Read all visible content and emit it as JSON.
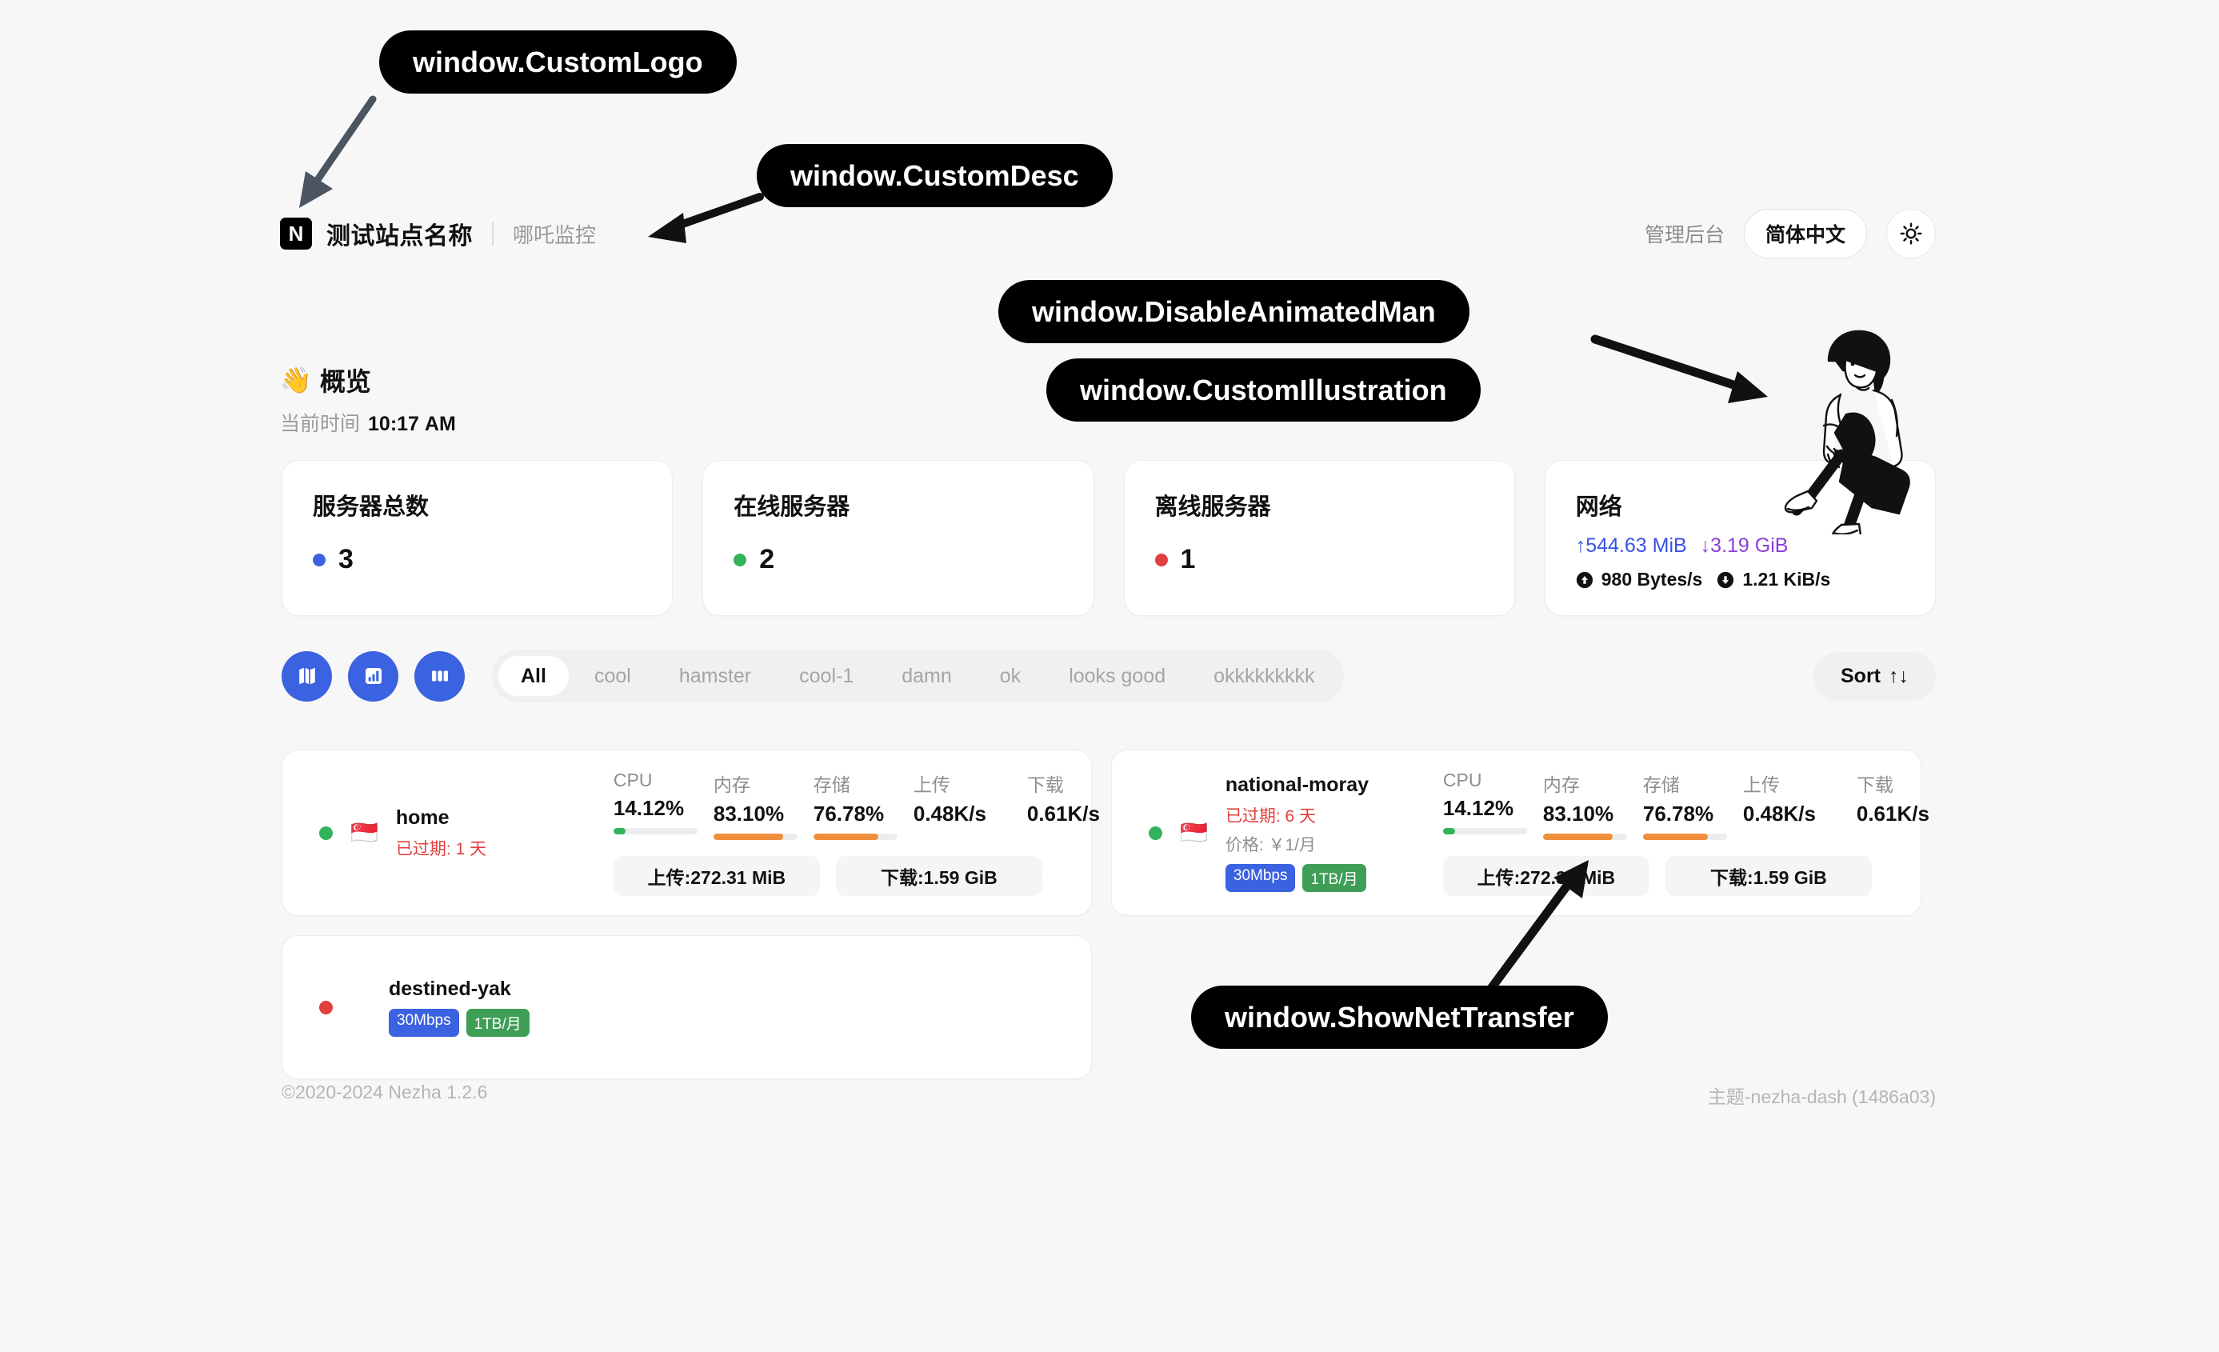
{
  "header": {
    "logo_letter": "N",
    "site_name": "测试站点名称",
    "site_desc": "哪吒监控",
    "admin_link": "管理后台",
    "language": "简体中文"
  },
  "overview": {
    "wave_emoji": "👋",
    "title": "概览",
    "time_label": "当前时间",
    "time_value": "10:17 AM"
  },
  "stats": [
    {
      "title": "服务器总数",
      "value": "3",
      "dot_color": "#3b62e0"
    },
    {
      "title": "在线服务器",
      "value": "2",
      "dot_color": "#35b35c"
    },
    {
      "title": "离线服务器",
      "value": "1",
      "dot_color": "#e0403f"
    }
  ],
  "network": {
    "title": "网络",
    "up_total": "↑544.63 MiB",
    "down_total": "↓3.19 GiB",
    "up_total_color": "#3b52e0",
    "down_total_color": "#8a3fd6",
    "up_speed": "980 Bytes/s",
    "down_speed": "1.21 KiB/s"
  },
  "filters": {
    "view_buttons": [
      "map-icon",
      "chart-icon",
      "columns-icon"
    ],
    "tabs": [
      "All",
      "cool",
      "hamster",
      "cool-1",
      "damn",
      "ok",
      "looks good",
      "okkkkkkkkk"
    ],
    "active_tab": "All",
    "sort_label": "Sort",
    "sort_icon": "↑↓",
    "accent_color": "#3b62e0"
  },
  "metric_labels": {
    "cpu": "CPU",
    "memory": "内存",
    "storage": "存储",
    "upload": "上传",
    "download": "下载"
  },
  "servers": [
    {
      "name": "home",
      "flag": "🇸🇬",
      "status_color": "#35b35c",
      "expire": "已过期: 1 天",
      "price": null,
      "badges": [],
      "has_metrics": true,
      "cpu": "14.12%",
      "cpu_pct": 14,
      "memory": "83.10%",
      "memory_pct": 83,
      "storage": "76.78%",
      "storage_pct": 77,
      "upload": "0.48K/s",
      "download": "0.61K/s",
      "transfer_up": "上传:272.31 MiB",
      "transfer_down": "下载:1.59 GiB"
    },
    {
      "name": "national-moray",
      "flag": "🇸🇬",
      "status_color": "#35b35c",
      "expire": "已过期: 6 天",
      "price": "价格: ￥1/月",
      "badges": [
        {
          "text": "30Mbps",
          "color": "blue"
        },
        {
          "text": "1TB/月",
          "color": "green"
        }
      ],
      "has_metrics": true,
      "cpu": "14.12%",
      "cpu_pct": 14,
      "memory": "83.10%",
      "memory_pct": 83,
      "storage": "76.78%",
      "storage_pct": 77,
      "upload": "0.48K/s",
      "download": "0.61K/s",
      "transfer_up": "上传:272.31 MiB",
      "transfer_down": "下载:1.59 GiB"
    },
    {
      "name": "destined-yak",
      "flag": null,
      "status_color": "#e0403f",
      "expire": null,
      "price": null,
      "badges": [
        {
          "text": "30Mbps",
          "color": "blue"
        },
        {
          "text": "1TB/月",
          "color": "green"
        }
      ],
      "has_metrics": false
    }
  ],
  "footer": {
    "left": "©2020-2024 Nezha 1.2.6",
    "right": "主题-nezha-dash (1486a03)"
  },
  "callouts": [
    {
      "text": "window.CustomLogo"
    },
    {
      "text": "window.CustomDesc"
    },
    {
      "text": "window.DisableAnimatedMan"
    },
    {
      "text": "window.CustomIllustration"
    },
    {
      "text": "window.ShowNetTransfer"
    }
  ]
}
